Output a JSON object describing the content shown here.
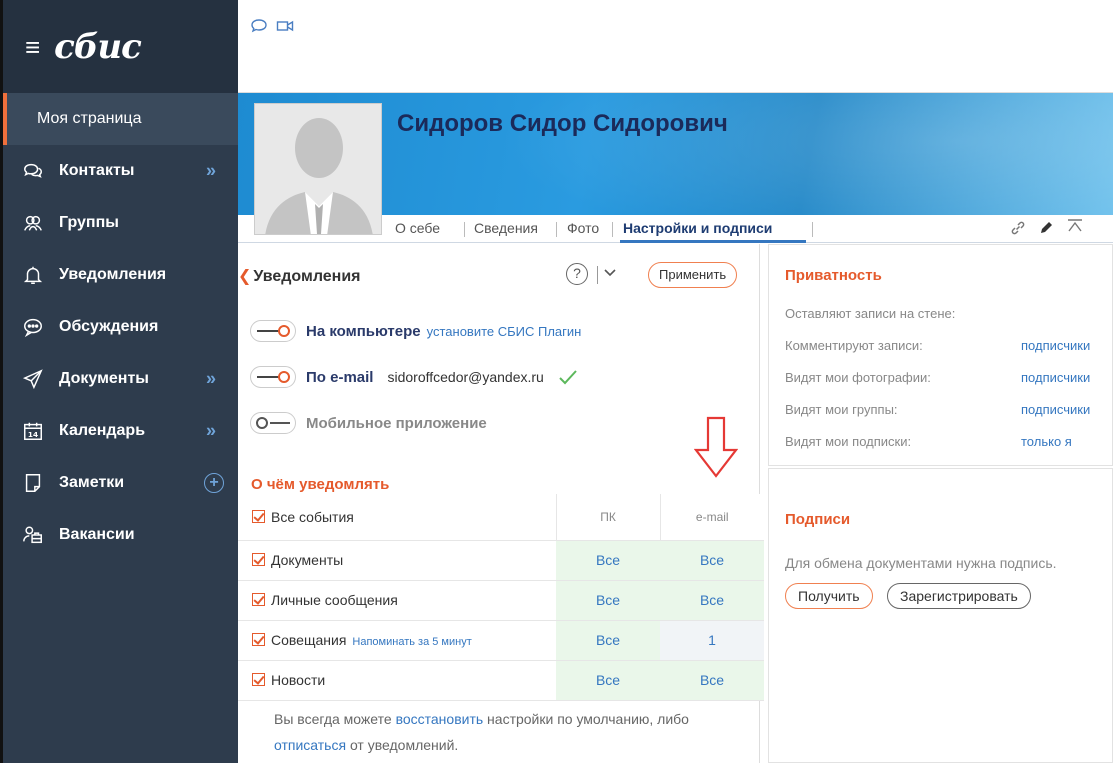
{
  "app": {
    "logo": "сбис"
  },
  "sidebar": {
    "items": [
      {
        "label": "Моя страница",
        "icon": "none",
        "expand": false
      },
      {
        "label": "Контакты",
        "icon": "chat-bubbles-icon",
        "expand": true
      },
      {
        "label": "Группы",
        "icon": "group-icon",
        "expand": false
      },
      {
        "label": "Уведомления",
        "icon": "bell-icon",
        "expand": false
      },
      {
        "label": "Обсуждения",
        "icon": "discussion-icon",
        "expand": false
      },
      {
        "label": "Документы",
        "icon": "send-icon",
        "expand": true
      },
      {
        "label": "Календарь",
        "icon": "calendar-icon",
        "calendar_day": "14",
        "expand": true
      },
      {
        "label": "Заметки",
        "icon": "note-icon",
        "add": true
      },
      {
        "label": "Вакансии",
        "icon": "vacancies-icon",
        "expand": false
      }
    ]
  },
  "profile": {
    "name": "Сидоров Сидор Сидорович",
    "tabs": [
      "О себе",
      "Сведения",
      "Фото",
      "Настройки и подписи"
    ],
    "active_tab": "Настройки и подписи"
  },
  "notifications": {
    "title": "Уведомления",
    "apply_label": "Применить",
    "help": "?",
    "channels": [
      {
        "label": "На компьютере",
        "link": "установите СБИС Плагин",
        "on": true
      },
      {
        "label": "По e-mail",
        "email": "sidoroffcedor@yandex.ru",
        "on": true,
        "verified": true
      },
      {
        "label": "Мобильное приложение",
        "on": false
      }
    ],
    "what_title": "О чём уведомлять",
    "columns": [
      "ПК",
      "e-mail"
    ],
    "all_events": "Все события",
    "rows": [
      {
        "name": "Документы",
        "pc": "Все",
        "email": "Все"
      },
      {
        "name": "Личные сообщения",
        "pc": "Все",
        "email": "Все"
      },
      {
        "name": "Совещания",
        "remind": "Напоминать за 5 минут",
        "pc": "Все",
        "email": "1"
      },
      {
        "name": "Новости",
        "pc": "Все",
        "email": "Все"
      }
    ],
    "footer": {
      "t1": "Вы всегда можете ",
      "link1": "восстановить",
      "t2": " настройки по умолчанию, либо ",
      "link2": "отписаться",
      "t3": " от уведомлений."
    }
  },
  "privacy": {
    "title": "Приватность",
    "rows": [
      {
        "label": "Оставляют записи на стене:",
        "value": ""
      },
      {
        "label": "Комментируют записи:",
        "value": "подписчики"
      },
      {
        "label": "Видят мои фотографии:",
        "value": "подписчики"
      },
      {
        "label": "Видят мои группы:",
        "value": "подписчики"
      },
      {
        "label": "Видят мои подписки:",
        "value": "только я"
      }
    ]
  },
  "signatures": {
    "title": "Подписи",
    "note": "Для обмена документами нужна подпись.",
    "get_label": "Получить",
    "register_label": "Зарегистрировать"
  },
  "colors": {
    "accent": "#e55a2c",
    "link": "#3577c0",
    "sidebar": "#2e3c4d"
  }
}
